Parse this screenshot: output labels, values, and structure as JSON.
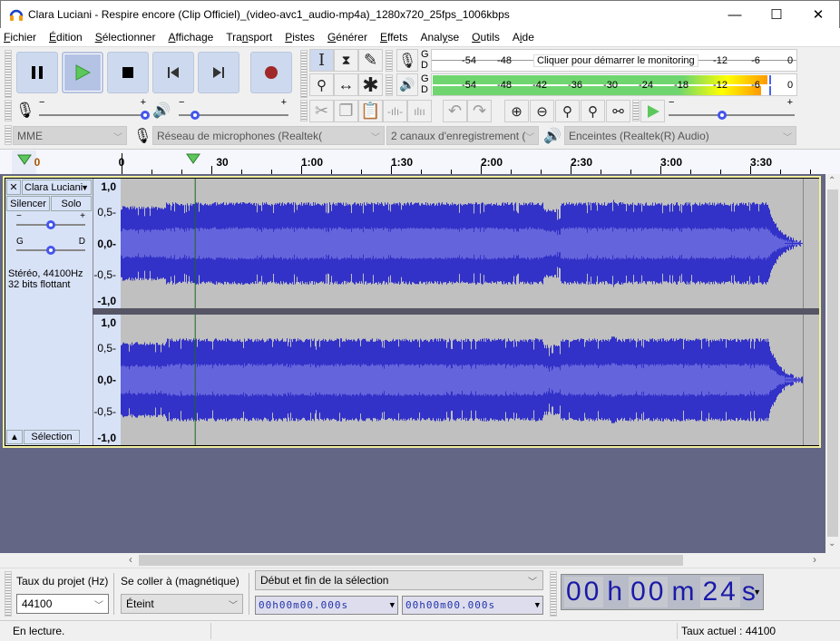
{
  "window": {
    "title": "Clara Luciani - Respire encore (Clip Officiel)_(video-avc1_audio-mp4a)_1280x720_25fps_1006kbps",
    "minimize": "—",
    "maximize": "☐",
    "close": "✕"
  },
  "menu": [
    {
      "label": "Fichier",
      "u": "F",
      "rest": "ichier"
    },
    {
      "label": "Édition",
      "u": "É",
      "rest": "dition"
    },
    {
      "label": "Sélectionner",
      "u": "S",
      "rest": "électionner"
    },
    {
      "label": "Affichage",
      "u": "A",
      "rest": "ffichage"
    },
    {
      "label": "Transport",
      "pre": "Tra",
      "u": "n",
      "rest": "sport"
    },
    {
      "label": "Pistes",
      "u": "P",
      "rest": "istes"
    },
    {
      "label": "Générer",
      "u": "G",
      "rest": "énérer"
    },
    {
      "label": "Effets",
      "u": "E",
      "rest": "ffets"
    },
    {
      "label": "Analyse",
      "pre": "Anal",
      "u": "y",
      "rest": "se"
    },
    {
      "label": "Outils",
      "u": "O",
      "rest": "utils"
    },
    {
      "label": "Aide",
      "pre": "A",
      "u": "i",
      "rest": "de"
    }
  ],
  "transport": {
    "pause": "pause-icon",
    "play": "play-icon",
    "stop": "stop-icon",
    "skip_start": "skip-start-icon",
    "skip_end": "skip-end-icon",
    "record": "record-icon",
    "play_active": true
  },
  "meters": {
    "record_channels": [
      "G",
      "D"
    ],
    "play_channels": [
      "G",
      "D"
    ],
    "record_ticks": [
      "-54",
      "-48",
      "-12",
      "-6",
      "0"
    ],
    "record_prompt": "Cliquer pour démarrer le monitoring",
    "play_ticks": [
      "-54",
      "-48",
      "-42",
      "-36",
      "-30",
      "-24",
      "-18",
      "-12",
      "-6",
      "0"
    ],
    "play_level_left_db": -4,
    "play_level_right_db": -5
  },
  "mixer": {
    "rec_minus": "−",
    "rec_plus": "+",
    "rec_volume": 1.0,
    "play_minus": "−",
    "play_plus": "+",
    "play_volume": 0.12
  },
  "play_at_speed": {
    "minus": "−",
    "plus": "+",
    "speed": 0.5
  },
  "devices": {
    "host": "MME",
    "recording_device": "Réseau de microphones (Realtek(",
    "channels": "2 canaux d'enregistrement (",
    "playback_device": "Enceintes (Realtek(R) Audio)"
  },
  "ruler": {
    "labels": [
      "0",
      "30",
      "1:00",
      "1:30",
      "2:00",
      "2:30",
      "3:00",
      "3:30"
    ],
    "pre_label": "0",
    "playhead_seconds": 24
  },
  "track": {
    "name": "Clara Luciani",
    "mute": "Silencer",
    "solo": "Solo",
    "gain_minus": "−",
    "gain_plus": "+",
    "pan_left": "G",
    "pan_right": "D",
    "info_line1": "Stéréo, 44100Hz",
    "info_line2": "32 bits flottant",
    "select": "Sélection",
    "y_labels": [
      "1,0",
      "0,5",
      "0,0",
      "-0,5",
      "-1,0"
    ]
  },
  "bottom": {
    "rate_label": "Taux du projet (Hz)",
    "rate_value": "44100",
    "snap_label": "Se coller à (magnétique)",
    "snap_value": "Éteint",
    "selection_mode": "Début et fin de la sélection",
    "sel_start": "00h00m00.000s",
    "sel_end": "00h00m00.000s",
    "time_h": "00",
    "time_h_unit": "h",
    "time_m": "00",
    "time_m_unit": "m",
    "time_s": "24",
    "time_s_unit": "s"
  },
  "status": {
    "state": "En lecture.",
    "rate": "Taux actuel : 44100"
  }
}
